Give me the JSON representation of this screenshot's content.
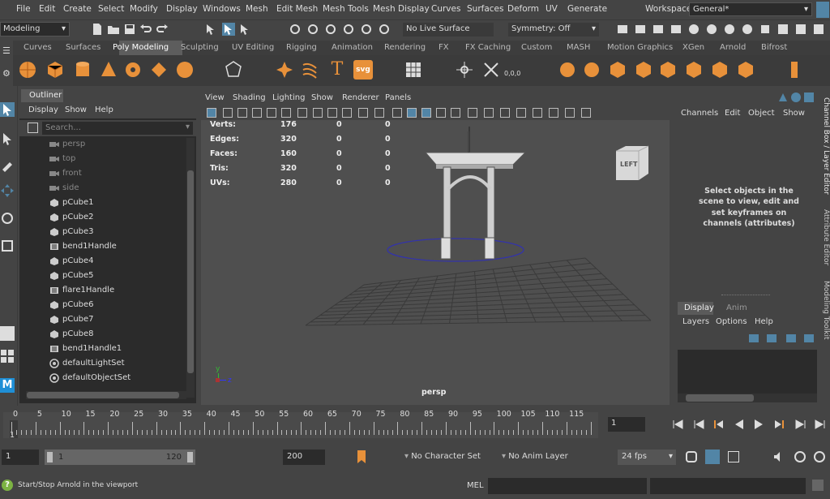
{
  "menubar": {
    "items": [
      "File",
      "Edit",
      "Create",
      "Select",
      "Modify",
      "Display",
      "Windows",
      "Mesh",
      "Edit Mesh",
      "Mesh Tools",
      "Mesh Display",
      "Curves",
      "Surfaces",
      "Deform",
      "UV",
      "Generate"
    ],
    "workspace_label": "Workspace:",
    "workspace_value": "General*"
  },
  "toolbar": {
    "mode": "Modeling",
    "live_surface": "No Live Surface",
    "symmetry": "Symmetry: Off"
  },
  "shelf": {
    "tabs": [
      "Curves",
      "Surfaces",
      "Poly Modeling",
      "Sculpting",
      "UV Editing",
      "Rigging",
      "Animation",
      "Rendering",
      "FX",
      "FX Caching",
      "Custom",
      "MASH",
      "Motion Graphics",
      "XGen",
      "Arnold",
      "Bifrost"
    ],
    "active": "Poly Modeling",
    "svg_label": "svg",
    "coord_label": "0,0,0"
  },
  "outliner": {
    "title": "Outliner",
    "menu": [
      "Display",
      "Show",
      "Help"
    ],
    "search_placeholder": "Search...",
    "items": [
      {
        "label": "persp",
        "icon": "camera-icon",
        "dim": true
      },
      {
        "label": "top",
        "icon": "camera-icon",
        "dim": true
      },
      {
        "label": "front",
        "icon": "camera-icon",
        "dim": true
      },
      {
        "label": "side",
        "icon": "camera-icon",
        "dim": true
      },
      {
        "label": "pCube1",
        "icon": "mesh-icon",
        "dim": false
      },
      {
        "label": "pCube2",
        "icon": "mesh-icon",
        "dim": false
      },
      {
        "label": "pCube3",
        "icon": "mesh-icon",
        "dim": false
      },
      {
        "label": "bend1Handle",
        "icon": "deformer-icon",
        "dim": false
      },
      {
        "label": "pCube4",
        "icon": "mesh-icon",
        "dim": false
      },
      {
        "label": "pCube5",
        "icon": "mesh-icon",
        "dim": false
      },
      {
        "label": "flare1Handle",
        "icon": "deformer-icon",
        "dim": false
      },
      {
        "label": "pCube6",
        "icon": "mesh-icon",
        "dim": false
      },
      {
        "label": "pCube7",
        "icon": "mesh-icon",
        "dim": false
      },
      {
        "label": "pCube8",
        "icon": "mesh-icon",
        "dim": false
      },
      {
        "label": "bend1Handle1",
        "icon": "deformer-icon",
        "dim": false
      },
      {
        "label": "defaultLightSet",
        "icon": "set-icon",
        "dim": false
      },
      {
        "label": "defaultObjectSet",
        "icon": "set-icon",
        "dim": false
      }
    ]
  },
  "viewport": {
    "menu": [
      "View",
      "Shading",
      "Lighting",
      "Show",
      "Renderer",
      "Panels"
    ],
    "camera_label": "persp",
    "cube_label": "LEFT",
    "hud": [
      {
        "name": "Verts:",
        "v1": "176",
        "v2": "0",
        "v3": "0"
      },
      {
        "name": "Edges:",
        "v1": "320",
        "v2": "0",
        "v3": "0"
      },
      {
        "name": "Faces:",
        "v1": "160",
        "v2": "0",
        "v3": "0"
      },
      {
        "name": "Tris:",
        "v1": "320",
        "v2": "0",
        "v3": "0"
      },
      {
        "name": "UVs:",
        "v1": "280",
        "v2": "0",
        "v3": "0"
      }
    ],
    "axis_y": "y",
    "axis_z": "z"
  },
  "channelbox": {
    "menu": [
      "Channels",
      "Edit",
      "Object",
      "Show"
    ],
    "message": "Select objects in the scene to view, edit and set keyframes on channels (attributes)",
    "side_tabs": [
      "Channel Box / Layer Editor",
      "Attribute Editor",
      "Modeling Toolkit"
    ]
  },
  "layers": {
    "tabs": [
      "Display",
      "Anim"
    ],
    "menu": [
      "Layers",
      "Options",
      "Help"
    ]
  },
  "timeline": {
    "ticks": [
      "0",
      "5",
      "10",
      "15",
      "20",
      "25",
      "30",
      "35",
      "40",
      "45",
      "50",
      "55",
      "60",
      "65",
      "70",
      "75",
      "80",
      "85",
      "90",
      "95",
      "100",
      "105",
      "110",
      "115"
    ],
    "current": "1",
    "frame_field": "1"
  },
  "range": {
    "start": "1",
    "inner_start": "1",
    "inner_end": "120",
    "end": "200",
    "character_set": "No Character Set",
    "anim_layer": "No Anim Layer",
    "fps": "24 fps"
  },
  "status": {
    "help_text": "Start/Stop Arnold in the viewport",
    "mel_label": "MEL"
  },
  "colors": {
    "accent": "#5285a6",
    "orange": "#e8913a",
    "bg": "#444444",
    "panel_dark": "#2b2b2b"
  }
}
